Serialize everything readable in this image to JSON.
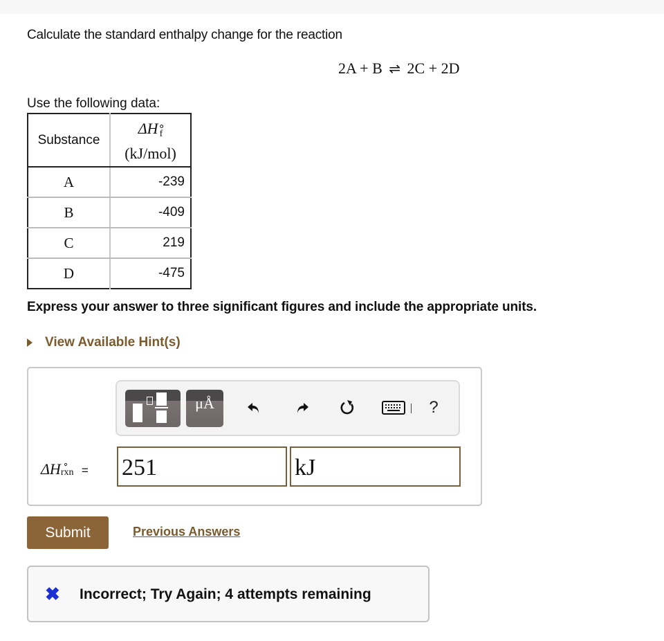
{
  "question": {
    "intro": "Calculate the standard enthalpy change for the reaction",
    "equation": {
      "left": "2A + B",
      "arrow": "⇌",
      "right": "2C + 2D"
    },
    "use_data_label": "Use the following data:"
  },
  "table": {
    "headers": {
      "substance": "Substance",
      "dh_symbol": "ΔH",
      "dh_sup": "∘",
      "dh_sub": "f",
      "dh_units": "(kJ/mol)"
    },
    "rows": [
      {
        "substance": "A",
        "value": "-239"
      },
      {
        "substance": "B",
        "value": "-409"
      },
      {
        "substance": "C",
        "value": "219"
      },
      {
        "substance": "D",
        "value": "-475"
      }
    ]
  },
  "instructions": "Express your answer to three significant figures and include the appropriate units.",
  "hint_link": "View Available Hint(s)",
  "toolbar": {
    "templates_icon": "templates-icon",
    "symbols_label": "μÅ",
    "undo_icon": "undo-icon",
    "redo_icon": "redo-icon",
    "reset_icon": "reset-icon",
    "keyboard_icon": "keyboard-icon",
    "help_label": "?"
  },
  "answer": {
    "lhs_symbol": "ΔH",
    "lhs_sup": "∘",
    "lhs_sub": "rxn",
    "equals": "=",
    "value": "251",
    "units": "kJ"
  },
  "actions": {
    "submit": "Submit",
    "previous_answers": "Previous Answers"
  },
  "feedback": {
    "icon": "✖",
    "message": "Incorrect; Try Again; 4 attempts remaining",
    "icon_color": "#1a2fd6"
  },
  "colors": {
    "accent": "#8b6437",
    "link": "#7a5b2e",
    "field_border": "#7c5f3a"
  }
}
